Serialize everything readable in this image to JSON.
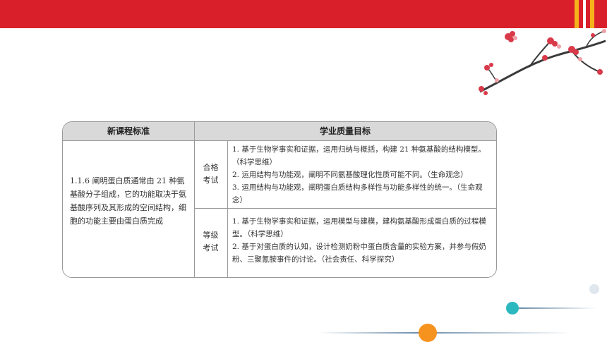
{
  "table": {
    "header_standard": "新课程标准",
    "header_goals": "学业质量目标",
    "standard_text": "1.1.6 阐明蛋白质通常由 21 种氨基酸分子组成，它的功能取决于氨基酸序列及其形成的空间结构，细胞的功能主要由蛋白质完成",
    "levels": [
      {
        "label_line1": "合格",
        "label_line2": "考试",
        "items": [
          "1. 基于生物学事实和证据，运用归纳与概括，构建 21 种氨基酸的结构模型。（科学思维）",
          "2. 运用结构与功能观，阐明不同氨基酸理化性质可能不同。（生命观念）",
          "3. 运用结构与功能观，阐明蛋白质结构多样性与功能多样性的统一。（生命观念）"
        ]
      },
      {
        "label_line1": "等级",
        "label_line2": "考试",
        "items": [
          "1. 基于生物学事实和证据，运用模型与建模，建构氨基酸形成蛋白质的过程模型。（科学思维）",
          "2. 基于对蛋白质的认知，设计检测奶粉中蛋白质含量的实验方案，并参与假奶粉、三聚氰胺事件的讨论。（社会责任、科学探究）"
        ]
      }
    ]
  },
  "colors": {
    "top_bar": "#d9202a",
    "stripe_accent": "#f6b21b",
    "header_fill": "#d9d9d9",
    "teal_dot": "#2cb8bf",
    "orange_dot": "#f6921e"
  },
  "decor": {
    "corner_art": "plum-blossom-branch-illustration"
  }
}
